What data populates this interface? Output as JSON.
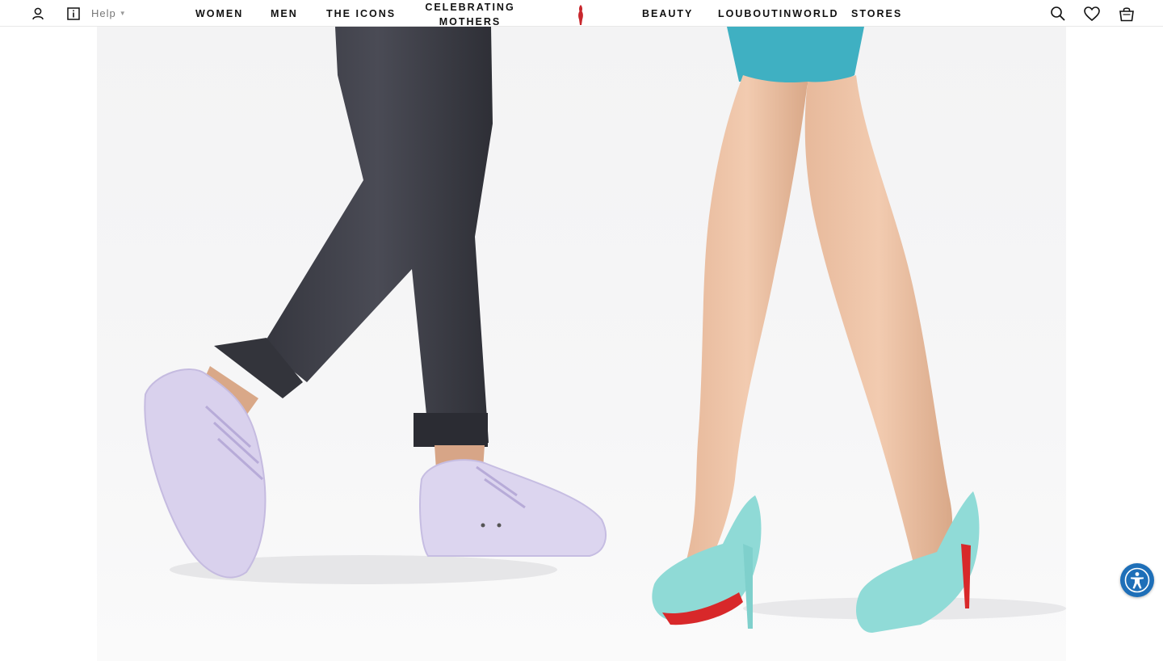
{
  "header": {
    "help_label": "Help",
    "nav_left": [
      {
        "label": "WOMEN"
      },
      {
        "label": "MEN"
      },
      {
        "label": "THE ICONS"
      }
    ],
    "nav_center": {
      "line1": "CELEBRATING",
      "line2": "MOTHERS"
    },
    "nav_right": [
      {
        "label": "BEAUTY"
      },
      {
        "label": "LOUBOUTINWORLD"
      },
      {
        "label": "STORES"
      }
    ],
    "icons": {
      "account": "user-icon",
      "info": "info-icon",
      "search": "search-icon",
      "wishlist": "heart-icon",
      "bag": "shopping-bag-icon",
      "logo": "louboutin-logo"
    }
  },
  "hero": {
    "image": "lavender-sneakers-and-turquoise-pumps",
    "colors": {
      "background": "#f4f4f5",
      "sneaker": "#d8d0ec",
      "pump": "#8fdad6",
      "sole": "#d8282a",
      "trousers": "#3f4049"
    }
  },
  "accessibility": {
    "icon": "accessibility-icon",
    "color": "#1e6fb8"
  }
}
